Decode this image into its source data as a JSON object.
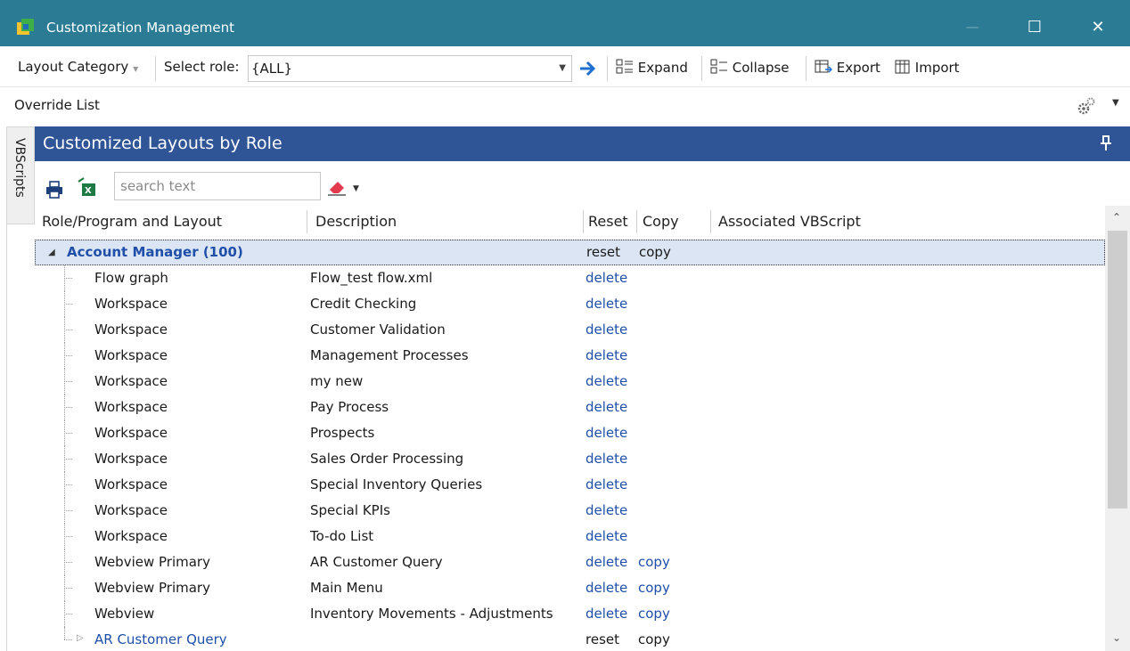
{
  "window": {
    "title": "Customization Management",
    "buttons": {
      "minimize": "—",
      "maximize": "☐",
      "close": "✕"
    }
  },
  "toolbar": {
    "layout_category": "Layout Category",
    "select_role_label": "Select role:",
    "role_value": "{ALL}",
    "expand": "Expand",
    "collapse": "Collapse",
    "export": "Export",
    "import": "Import"
  },
  "override_list": "Override List",
  "side_tab": "VBScripts",
  "panel": {
    "title": "Customized Layouts by Role"
  },
  "search": {
    "placeholder": "search text"
  },
  "columns": {
    "role_program_layout": "Role/Program and Layout",
    "description": "Description",
    "reset": "Reset",
    "copy": "Copy",
    "associated_vbscript": "Associated VBScript"
  },
  "group": {
    "label": "Account Manager (100)",
    "reset": "reset",
    "copy": "copy"
  },
  "rows": [
    {
      "layout": "Flow graph",
      "description": "Flow_test flow.xml",
      "reset": "delete",
      "copy": ""
    },
    {
      "layout": "Workspace",
      "description": "Credit Checking",
      "reset": "delete",
      "copy": ""
    },
    {
      "layout": "Workspace",
      "description": "Customer Validation",
      "reset": "delete",
      "copy": ""
    },
    {
      "layout": "Workspace",
      "description": "Management Processes",
      "reset": "delete",
      "copy": ""
    },
    {
      "layout": "Workspace",
      "description": "my new",
      "reset": "delete",
      "copy": ""
    },
    {
      "layout": "Workspace",
      "description": "Pay Process",
      "reset": "delete",
      "copy": ""
    },
    {
      "layout": "Workspace",
      "description": "Prospects",
      "reset": "delete",
      "copy": ""
    },
    {
      "layout": "Workspace",
      "description": "Sales Order Processing",
      "reset": "delete",
      "copy": ""
    },
    {
      "layout": "Workspace",
      "description": "Special Inventory Queries",
      "reset": "delete",
      "copy": ""
    },
    {
      "layout": "Workspace",
      "description": "Special KPIs",
      "reset": "delete",
      "copy": ""
    },
    {
      "layout": "Workspace",
      "description": "To-do List",
      "reset": "delete",
      "copy": ""
    },
    {
      "layout": "Webview Primary",
      "description": "AR Customer Query",
      "reset": "delete",
      "copy": "copy"
    },
    {
      "layout": "Webview Primary",
      "description": "Main Menu",
      "reset": "delete",
      "copy": "copy"
    },
    {
      "layout": "Webview",
      "description": "Inventory Movements - Adjustments",
      "reset": "delete",
      "copy": "copy"
    }
  ],
  "subgroup": {
    "label": "AR Customer Query",
    "reset": "reset",
    "copy": "copy"
  },
  "colors": {
    "titlebar": "#2b7b95",
    "panel_header": "#2f5597",
    "link": "#1f4fa8",
    "group_row": "#dbe5f3"
  }
}
